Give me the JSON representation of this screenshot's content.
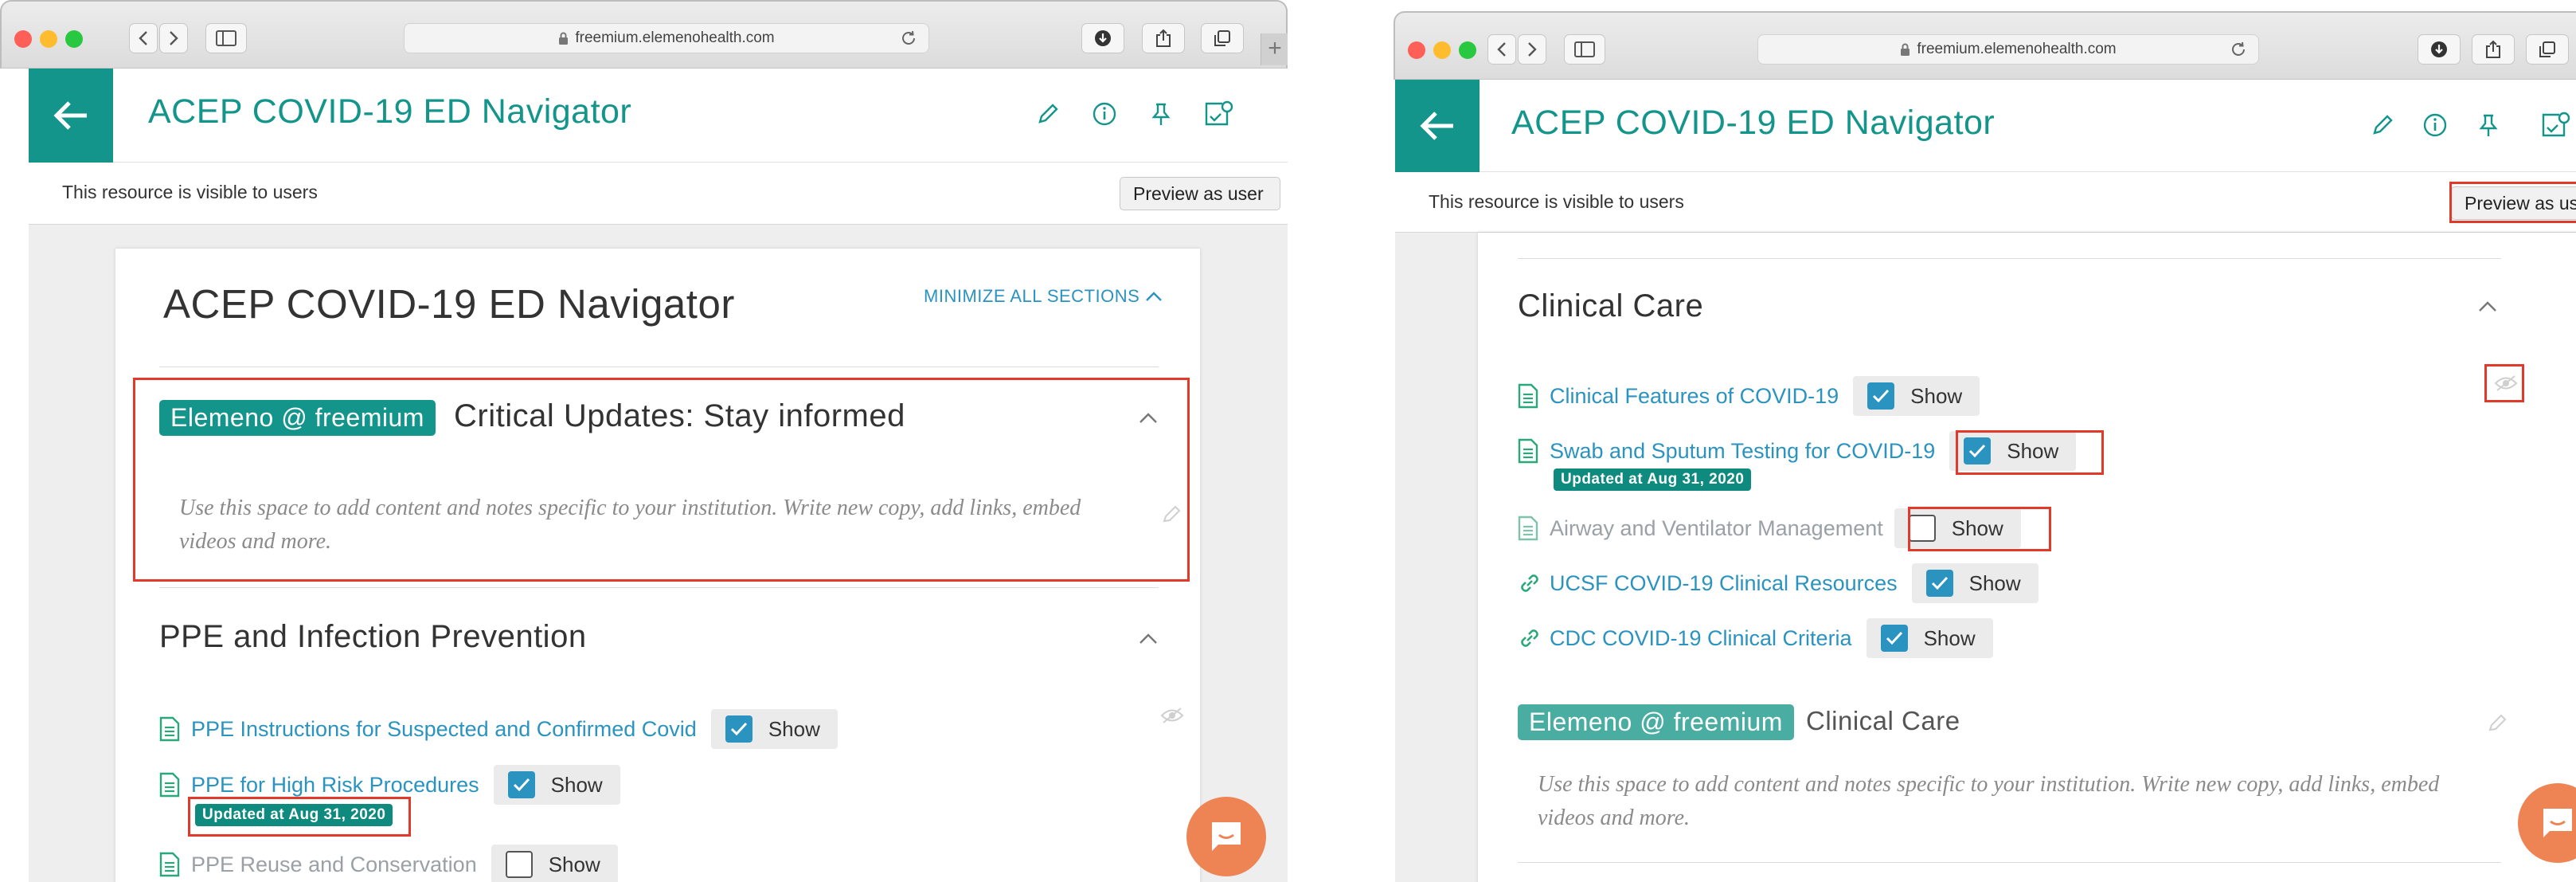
{
  "colors": {
    "teal": "#14958b",
    "link_blue": "#2a93c0",
    "highlight_red": "#e23a2a",
    "chat_orange": "#ee8454"
  },
  "browser": {
    "url": "freemium.elemenohealth.com"
  },
  "header": {
    "title": "ACEP COVID-19 ED Navigator",
    "icons": [
      "edit-icon",
      "info-icon",
      "pin-icon",
      "share-icon"
    ]
  },
  "visibility": {
    "text": "This resource is visible to users",
    "preview_label": "Preview as user",
    "preview_label_cropped": "Preview as us"
  },
  "left": {
    "page_title": "ACEP COVID-19 ED Navigator",
    "minimize_label": "MINIMIZE ALL SECTIONS",
    "critical": {
      "badge": "Elemeno @ freemium",
      "title": "Critical Updates: Stay informed",
      "note": "Use this space to add content and notes specific to your institution. Write new copy, add links, embed videos and more."
    },
    "ppe": {
      "title": "PPE and Infection Prevention",
      "items": [
        {
          "label": "PPE Instructions for Suspected and Confirmed Covid",
          "show": "Show",
          "checked": true
        },
        {
          "label": "PPE for High Risk Procedures",
          "show": "Show",
          "checked": true,
          "updated": "Updated at Aug 31, 2020"
        },
        {
          "label": "PPE Reuse and Conservation",
          "show": "Show",
          "checked": false
        }
      ]
    }
  },
  "right": {
    "section_title": "Clinical Care",
    "items": [
      {
        "label": "Clinical Features of COVID-19",
        "show": "Show",
        "checked": true,
        "type": "document-icon"
      },
      {
        "label": "Swab and Sputum Testing for COVID-19",
        "show": "Show",
        "checked": true,
        "type": "document-icon",
        "updated": "Updated at Aug 31, 2020"
      },
      {
        "label": "Airway and Ventilator Management",
        "show": "Show",
        "checked": false,
        "type": "document-icon"
      },
      {
        "label": "UCSF COVID-19 Clinical Resources",
        "show": "Show",
        "checked": true,
        "type": "link-icon"
      },
      {
        "label": "CDC COVID-19 Clinical Criteria",
        "show": "Show",
        "checked": true,
        "type": "link-icon"
      }
    ],
    "local": {
      "badge": "Elemeno @ freemium",
      "title": "Clinical Care",
      "note": "Use this space to add content and notes specific to your institution. Write new copy, add links, embed videos and more."
    }
  }
}
